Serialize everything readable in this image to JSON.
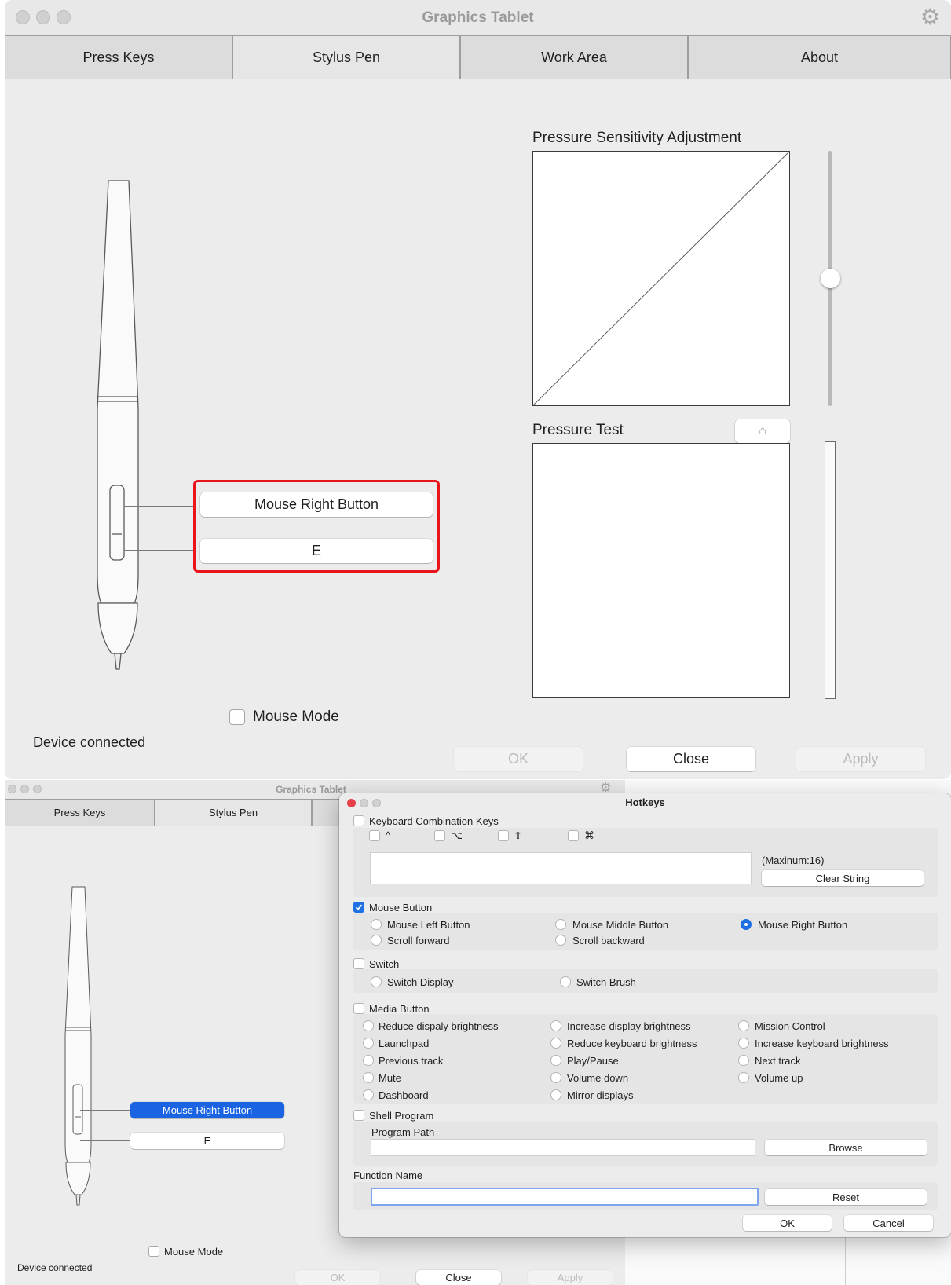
{
  "main_window": {
    "title": "Graphics Tablet",
    "tabs": [
      {
        "label": "Press Keys"
      },
      {
        "label": "Stylus Pen"
      },
      {
        "label": "Work Area"
      },
      {
        "label": "About"
      }
    ],
    "pen_buttons": {
      "upper": "Mouse Right Button",
      "lower": "E"
    },
    "pressure_sensitivity_title": "Pressure Sensitivity Adjustment",
    "pressure_test_title": "Pressure Test",
    "mouse_mode_label": "Mouse Mode",
    "status": "Device connected",
    "ok_label": "OK",
    "close_label": "Close",
    "apply_label": "Apply",
    "highlight_color": "#e8161c"
  },
  "back_window": {
    "title": "Graphics Tablet",
    "tabs": [
      {
        "label": "Press Keys"
      },
      {
        "label": "Stylus Pen"
      }
    ],
    "pen_buttons": {
      "upper": "Mouse Right Button",
      "lower": "E"
    },
    "mouse_mode_label": "Mouse Mode",
    "status": "Device connected",
    "ok_label": "OK",
    "close_label": "Close",
    "apply_label": "Apply",
    "selected_button_color": "#1a64e4"
  },
  "hotkeys": {
    "title": "Hotkeys",
    "keyboard": {
      "label": "Keyboard Combination Keys",
      "modifiers": [
        "^",
        "⌥",
        "⇧",
        "⌘"
      ],
      "max_note": "(Maxinum:16)",
      "clear_label": "Clear String"
    },
    "mouse": {
      "label": "Mouse Button",
      "checked": true,
      "options": [
        "Mouse Left Button",
        "Mouse Middle Button",
        "Mouse Right Button",
        "Scroll forward",
        "Scroll backward"
      ],
      "selected": "Mouse Right Button"
    },
    "switch": {
      "label": "Switch",
      "options": [
        "Switch Display",
        "Switch Brush"
      ]
    },
    "media": {
      "label": "Media Button",
      "options": [
        "Reduce dispaly brightness",
        "Increase display brightness",
        "Mission Control",
        "Launchpad",
        "Reduce keyboard brightness",
        "Increase keyboard brightness",
        "Previous track",
        "Play/Pause",
        "Next track",
        "Mute",
        "Volume down",
        "Volume up",
        "Dashboard",
        "Mirror displays"
      ]
    },
    "shell": {
      "label": "Shell Program",
      "path_label": "Program Path",
      "browse_label": "Browse"
    },
    "function_name_label": "Function Name",
    "reset_label": "Reset",
    "ok_label": "OK",
    "cancel_label": "Cancel",
    "accent_color": "#1f6fe5"
  }
}
